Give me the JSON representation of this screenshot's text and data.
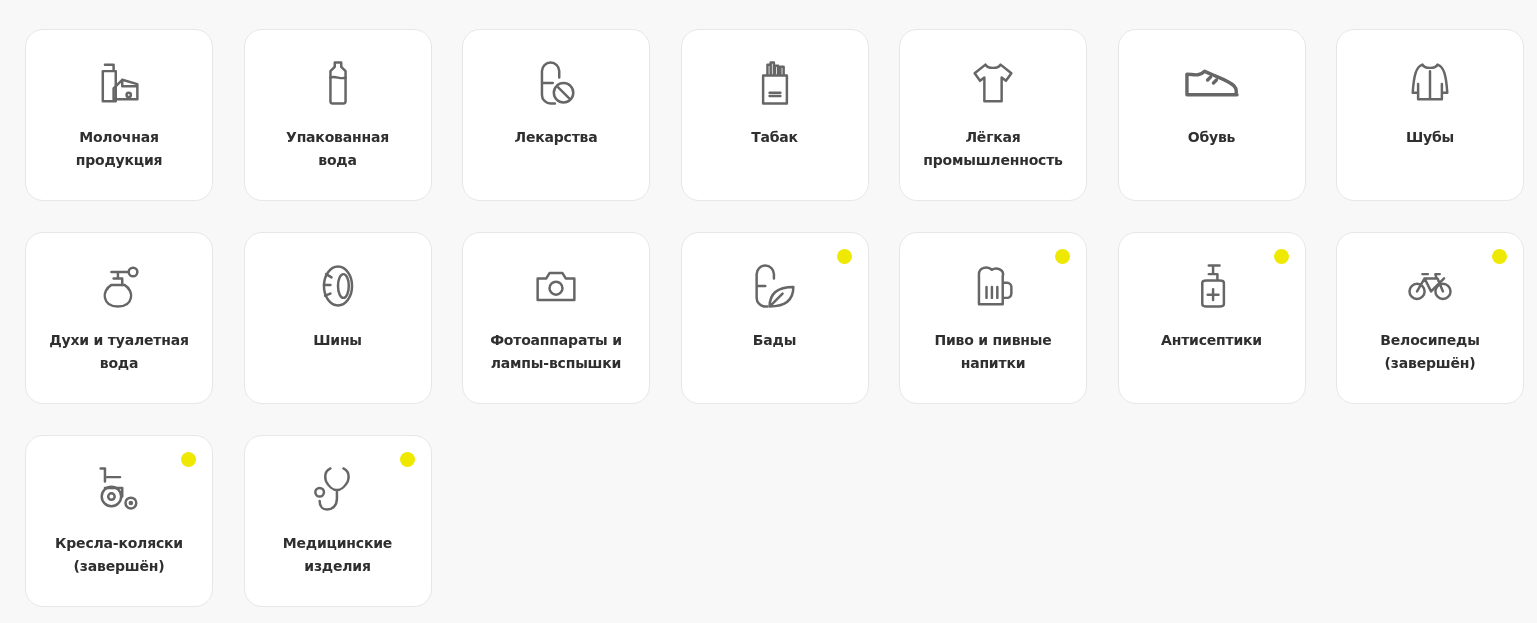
{
  "categories": [
    {
      "label": "Молочная\nпродукция",
      "marked": false
    },
    {
      "label": "Упакованная\nвода",
      "marked": false
    },
    {
      "label": "Лекарства",
      "marked": false
    },
    {
      "label": "Табак",
      "marked": false
    },
    {
      "label": "Лёгкая\nпромышленность",
      "marked": false
    },
    {
      "label": "Обувь",
      "marked": false
    },
    {
      "label": "Шубы",
      "marked": false
    },
    {
      "label": "Духи и туалетная\nвода",
      "marked": false
    },
    {
      "label": "Шины",
      "marked": false
    },
    {
      "label": "Фотоаппараты и\nлампы-вспышки",
      "marked": false
    },
    {
      "label": "Бады",
      "marked": true
    },
    {
      "label": "Пиво и пивные\nнапитки",
      "marked": true
    },
    {
      "label": "Антисептики",
      "marked": true
    },
    {
      "label": "Велосипеды\n(завершён)",
      "marked": true
    },
    {
      "label": "Кресла-коляски\n(завершён)",
      "marked": true
    },
    {
      "label": "Медицинские\nизделия",
      "marked": true
    }
  ]
}
